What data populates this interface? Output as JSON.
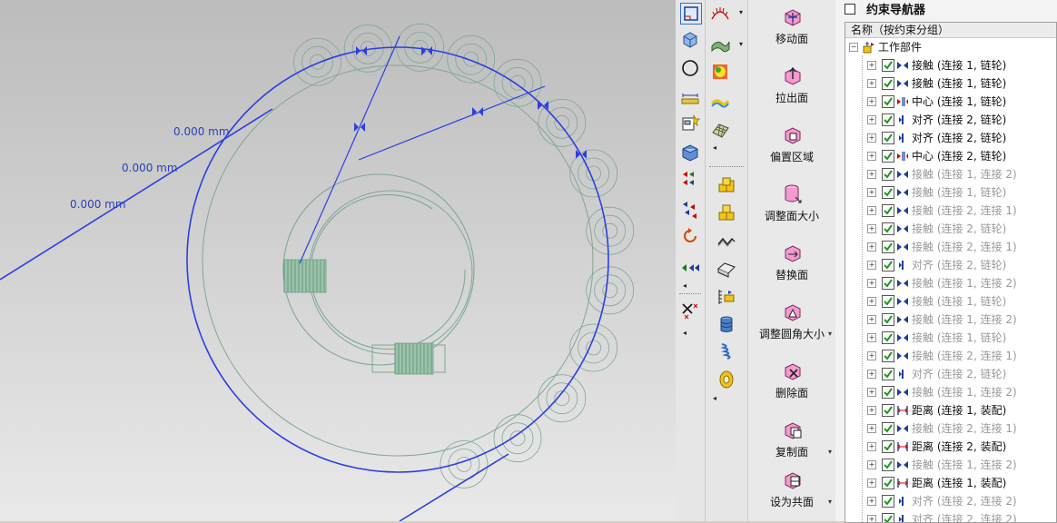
{
  "viewport": {
    "dimensions": [
      "0.000 mm",
      "0.000 mm",
      "0.000 mm"
    ]
  },
  "toolbar_left": {
    "icons": [
      "select-frame-icon",
      "cube-view-icon",
      "circle-icon",
      "ruler-icon",
      "add-component-icon",
      "block-icon",
      "move-constraint-icon",
      "move-constraint-icon-2",
      "rotate-icon",
      "swap-icon"
    ],
    "bottom": [
      "delete-constraint-icon"
    ]
  },
  "toolbar_mid": {
    "icons": [
      "spring-icon",
      "surface-icon",
      "color-sphere-icon",
      "wave-icon",
      "mesh-icon"
    ],
    "icons2": [
      "coin-stack-icon",
      "coin-stack-icon-2",
      "wave-line-icon",
      "bent-sheet-icon",
      "measure-icon",
      "cylinder-stack-icon",
      "spring-coil-icon",
      "gear-ring-icon"
    ]
  },
  "sync_panel": {
    "buttons": [
      {
        "label": "移动面"
      },
      {
        "label": "拉出面"
      },
      {
        "label": "偏置区域"
      },
      {
        "label": "调整面大小"
      },
      {
        "label": "替换面"
      },
      {
        "label": "调整圆角大小"
      },
      {
        "label": "删除面"
      },
      {
        "label": "复制面"
      },
      {
        "label": "设为共面"
      }
    ]
  },
  "navigator": {
    "title": "约束导航器",
    "header": "名称（按约束分组）",
    "root": "工作部件",
    "rows": [
      {
        "type": "接触",
        "label": "接触 (连接 1, 链轮)",
        "active": true,
        "icon": "touch"
      },
      {
        "type": "接触",
        "label": "接触 (连接 1, 链轮)",
        "active": true,
        "icon": "touch"
      },
      {
        "type": "中心",
        "label": "中心 (连接 1, 链轮)",
        "active": true,
        "icon": "center"
      },
      {
        "type": "对齐",
        "label": "对齐 (连接 2, 链轮)",
        "active": true,
        "icon": "align"
      },
      {
        "type": "对齐",
        "label": "对齐 (连接 2, 链轮)",
        "active": true,
        "icon": "align"
      },
      {
        "type": "中心",
        "label": "中心 (连接 2, 链轮)",
        "active": true,
        "icon": "center"
      },
      {
        "type": "接触",
        "label": "接触 (连接 1, 连接 2)",
        "active": false,
        "icon": "touch"
      },
      {
        "type": "接触",
        "label": "接触 (连接 1, 链轮)",
        "active": false,
        "icon": "touch"
      },
      {
        "type": "接触",
        "label": "接触 (连接 2, 连接 1)",
        "active": false,
        "icon": "touch"
      },
      {
        "type": "接触",
        "label": "接触 (连接 2, 链轮)",
        "active": false,
        "icon": "touch"
      },
      {
        "type": "接触",
        "label": "接触 (连接 2, 连接 1)",
        "active": false,
        "icon": "touch"
      },
      {
        "type": "对齐",
        "label": "对齐 (连接 2, 链轮)",
        "active": false,
        "icon": "align"
      },
      {
        "type": "接触",
        "label": "接触 (连接 1, 连接 2)",
        "active": false,
        "icon": "touch"
      },
      {
        "type": "接触",
        "label": "接触 (连接 1, 链轮)",
        "active": false,
        "icon": "touch"
      },
      {
        "type": "接触",
        "label": "接触 (连接 1, 连接 2)",
        "active": false,
        "icon": "touch"
      },
      {
        "type": "接触",
        "label": "接触 (连接 1, 链轮)",
        "active": false,
        "icon": "touch"
      },
      {
        "type": "接触",
        "label": "接触 (连接 2, 连接 1)",
        "active": false,
        "icon": "touch"
      },
      {
        "type": "对齐",
        "label": "对齐 (连接 2, 链轮)",
        "active": false,
        "icon": "align"
      },
      {
        "type": "接触",
        "label": "接触 (连接 1, 连接 2)",
        "active": false,
        "icon": "touch"
      },
      {
        "type": "距离",
        "label": "距离 (连接 1, 装配)",
        "active": true,
        "icon": "distance"
      },
      {
        "type": "接触",
        "label": "接触 (连接 2, 连接 1)",
        "active": false,
        "icon": "touch"
      },
      {
        "type": "距离",
        "label": "距离 (连接 2, 装配)",
        "active": true,
        "icon": "distance"
      },
      {
        "type": "接触",
        "label": "接触 (连接 1, 连接 2)",
        "active": false,
        "icon": "touch"
      },
      {
        "type": "距离",
        "label": "距离 (连接 1, 装配)",
        "active": true,
        "icon": "distance"
      },
      {
        "type": "对齐",
        "label": "对齐 (连接 2, 连接 2)",
        "active": false,
        "icon": "align"
      },
      {
        "type": "对齐",
        "label": "对齐 (连接 2, 连接 2)",
        "active": false,
        "icon": "align"
      }
    ]
  }
}
